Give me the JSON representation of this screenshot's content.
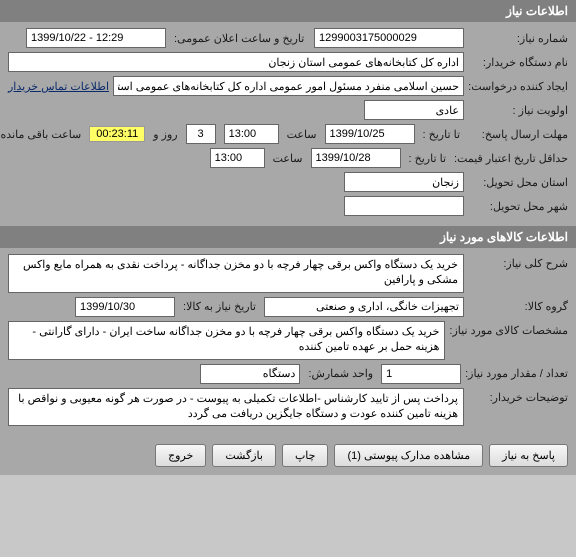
{
  "sections": {
    "need_info": "اطلاعات نیاز",
    "goods_info": "اطلاعات کالاهای مورد نیاز"
  },
  "labels": {
    "need_number": "شماره نیاز:",
    "public_announce_dt": "تاریخ و ساعت اعلان عمومی:",
    "buyer_org": "نام دستگاه خریدار:",
    "creator": "ایجاد کننده درخواست:",
    "contact_link": "اطلاعات تماس خریدار",
    "priority": "اولویت نیاز :",
    "deadline": "مهلت ارسال پاسخ:",
    "to_date": "تا تاریخ :",
    "hour": "ساعت",
    "days_and": "روز و",
    "remaining": "ساعت باقی مانده",
    "min_valid": "حداقل تاریخ اعتبار قیمت:",
    "delivery_province": "استان محل تحویل:",
    "delivery_city": "شهر محل تحویل:",
    "general_desc": "شرح کلی نیاز:",
    "goods_group": "گروه کالا:",
    "goods_date": "تاریخ نیاز به کالا:",
    "goods_spec": "مشخصات کالای مورد نیاز:",
    "qty": "تعداد / مقدار مورد نیاز:",
    "unit": "واحد شمارش:",
    "buyer_notes": "توضیحات خریدار:"
  },
  "values": {
    "need_number": "1299003175000029",
    "public_announce_dt": "1399/10/22 - 12:29",
    "buyer_org": "اداره کل کتابخانه‌های عمومی استان زنجان",
    "creator": "حسین اسلامی منفرد مسئول امور عمومی اداره کل کتابخانه‌های عمومی استان",
    "priority": "عادی",
    "deadline_date": "1399/10/25",
    "deadline_time": "13:00",
    "remain_days": "3",
    "remain_time": "00:23:11",
    "valid_date": "1399/10/28",
    "valid_time": "13:00",
    "delivery_province": "زنجان",
    "delivery_city": "",
    "general_desc": "خرید یک دستگاه واکس برقی چهار فرچه با دو مخزن جداگانه - پرداخت نقدی به همراه مایع واکس مشکی و پارافین",
    "goods_group": "تجهیزات خانگی، اداری و صنعتی",
    "goods_date": "1399/10/30",
    "goods_spec": "خرید یک دستگاه واکس برقی چهار فرچه با دو مخزن جداگانه ساخت ایران - دارای گارانتی - هزینه حمل بر عهده تامین کننده",
    "qty": "1",
    "unit": "دستگاه",
    "buyer_notes": "پرداخت پس از تایید کارشناس -اطلاعات تکمیلی به پیوست - در صورت هر گونه معیوبی و نواقص با هزینه تامین کننده عودت و دستگاه جایگزین دریافت می گردد"
  },
  "buttons": {
    "respond": "پاسخ به نیاز",
    "attachments": "مشاهده مدارک پیوستی  (1)",
    "print": "چاپ",
    "back": "بازگشت",
    "exit": "خروج"
  }
}
